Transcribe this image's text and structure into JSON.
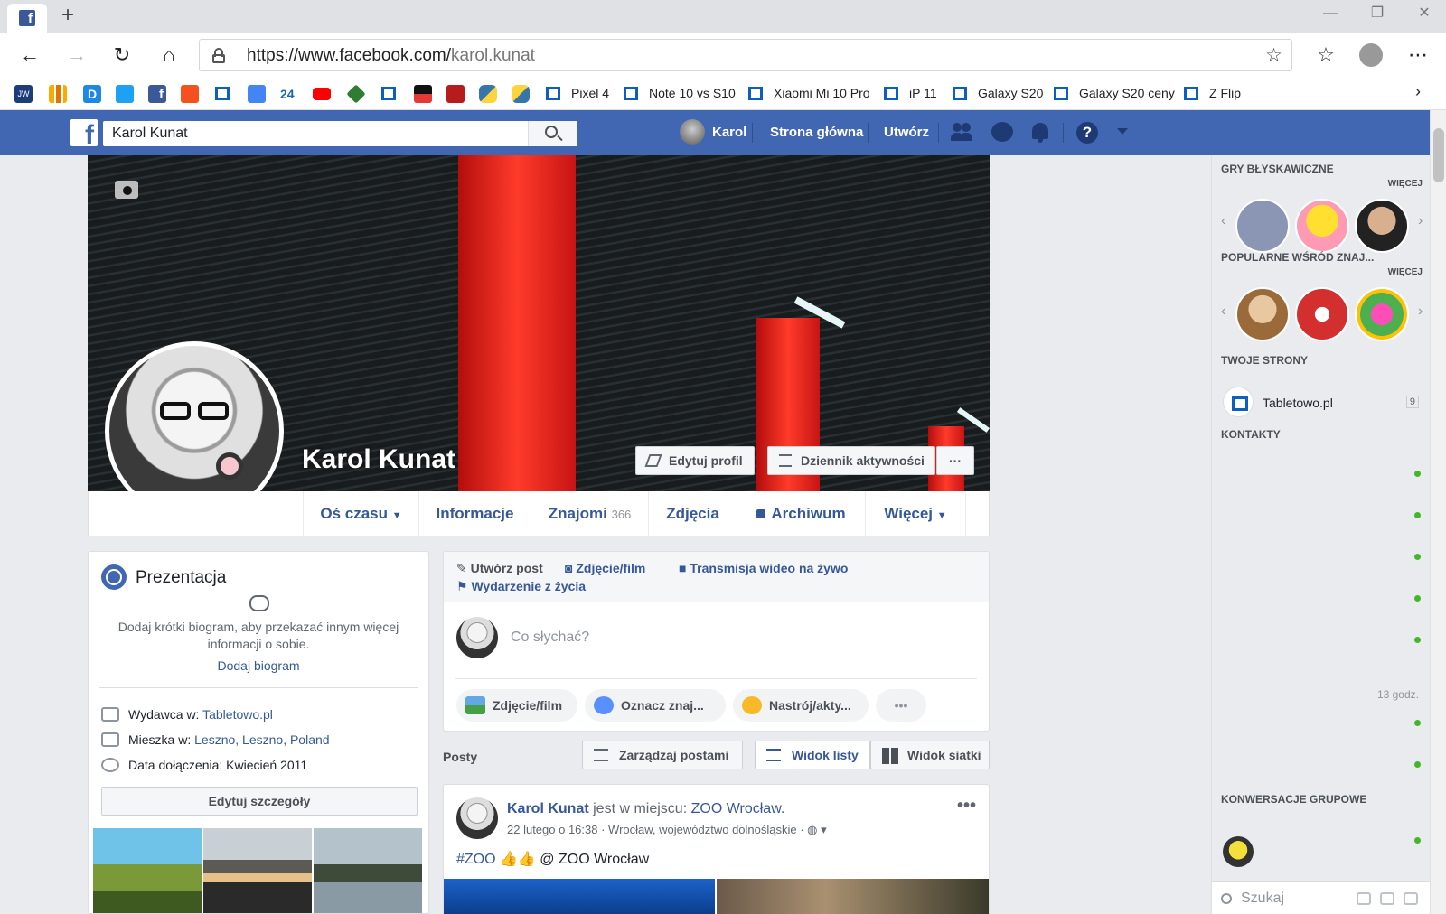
{
  "browser": {
    "new_tab": "+",
    "url_host": "https://www.facebook.com/",
    "url_path": "karol.kunat",
    "minimize": "—",
    "restore": "❐",
    "close": "✕",
    "more": "⋯",
    "bookmarks": [
      {
        "label": "Pixel 4"
      },
      {
        "label": "Note 10 vs S10"
      },
      {
        "label": "Xiaomi Mi 10 Pro"
      },
      {
        "label": "iP 11"
      },
      {
        "label": "Galaxy S20"
      },
      {
        "label": "Galaxy S20 ceny"
      },
      {
        "label": "Z Flip"
      }
    ],
    "bookmark_icons": [
      "JW",
      "",
      "D",
      "",
      "f",
      "",
      "",
      "",
      "24"
    ]
  },
  "fb_header": {
    "search_value": "Karol Kunat",
    "user": "Karol",
    "home": "Strona główna",
    "create": "Utwórz"
  },
  "profile": {
    "name": "Karol Kunat",
    "edit_profile": "Edytuj profil",
    "activity_log": "Dziennik aktywności",
    "more_dots": "···",
    "tabs": {
      "timeline": "Oś czasu",
      "about": "Informacje",
      "friends": "Znajomi",
      "friends_count": "366",
      "photos": "Zdjęcia",
      "archive": "Archiwum",
      "more": "Więcej"
    }
  },
  "intro": {
    "title": "Prezentacja",
    "bio_text": "Dodaj krótki biogram, aby przekazać innym więcej informacji o sobie.",
    "add_bio": "Dodaj biogram",
    "work_prefix": "Wydawca w: ",
    "work_link": "Tabletowo.pl",
    "lives_prefix": "Mieszka w: ",
    "lives_link": "Leszno, Leszno, Poland",
    "joined": "Data dołączenia: Kwiecień 2011",
    "edit_details": "Edytuj szczegóły"
  },
  "composer": {
    "create_post": "Utwórz post",
    "photo_video": "Zdjęcie/film",
    "live": "Transmisja wideo na żywo",
    "life_event": "Wydarzenie z życia",
    "placeholder": "Co słychać?",
    "pill_photo": "Zdjęcie/film",
    "pill_tag": "Oznacz znaj...",
    "pill_feeling": "Nastrój/akty...",
    "pill_more": "•••"
  },
  "posts_bar": {
    "label": "Posty",
    "manage": "Zarządzaj postami",
    "list_view": "Widok listy",
    "grid_view": "Widok siatki"
  },
  "post": {
    "author": "Karol Kunat",
    "action": " jest w miejscu: ",
    "place": "ZOO Wrocław.",
    "date": "22 lutego o 16:38",
    "location": " · Wrocław, województwo dolnośląskie · ",
    "text_hash": "#ZOO",
    "text_rest": " 👍👍 @ ZOO Wrocław",
    "dots": "•••"
  },
  "sidebar": {
    "instant_games": "GRY BŁYSKAWICZNE",
    "more1": "WIĘCEJ",
    "popular": "POPULARNE WŚRÓD ZNAJ...",
    "more2": "WIĘCEJ",
    "your_pages": "TWOJE STRONY",
    "page_name": "Tabletowo.pl",
    "page_count": "9",
    "contacts": "KONTAKTY",
    "time": "13 godz.",
    "group_chats": "KONWERSACJE GRUPOWE",
    "search_placeholder": "Szukaj"
  },
  "colors": {
    "fb_blue": "#4267b2",
    "link": "#365899",
    "online": "#42b72a"
  }
}
